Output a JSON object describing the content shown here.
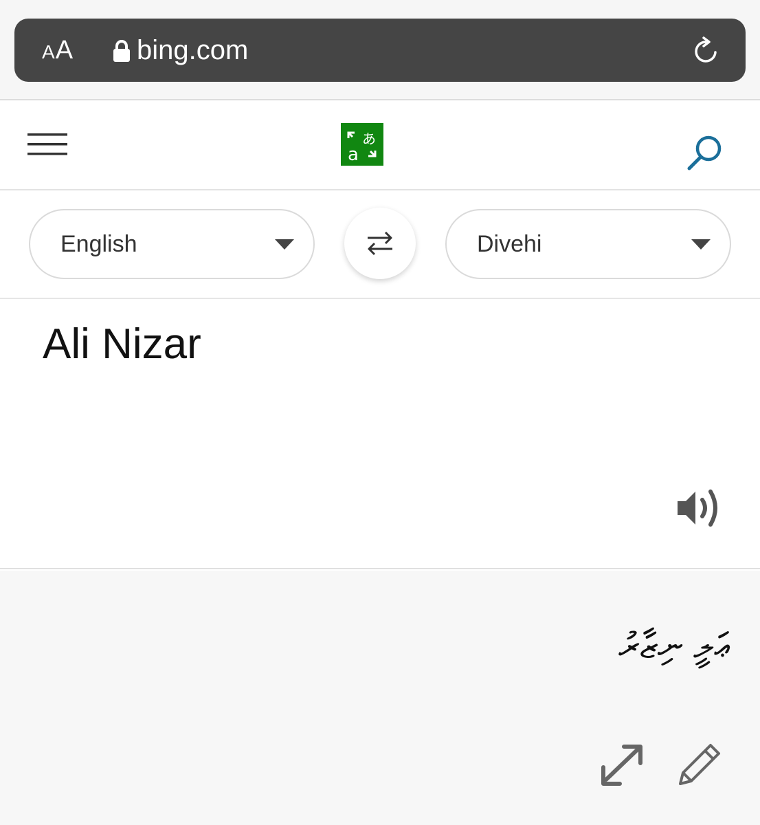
{
  "browser": {
    "text_size_label_small": "A",
    "text_size_label_large": "A",
    "url": "bing.com"
  },
  "translator": {
    "source_language": "English",
    "target_language": "Divehi",
    "source_text": "Ali Nizar",
    "translated_text": "ޢަލީ ނިޒާރު"
  },
  "colors": {
    "logo_green": "#118711",
    "search_blue": "#1b6f9a",
    "url_bar_bg": "#454545"
  },
  "icons": [
    "lock-icon",
    "reload-icon",
    "menu-icon",
    "translator-logo",
    "search-icon",
    "chevron-down-icon",
    "swap-icon",
    "speaker-icon",
    "expand-icon",
    "pencil-icon"
  ]
}
